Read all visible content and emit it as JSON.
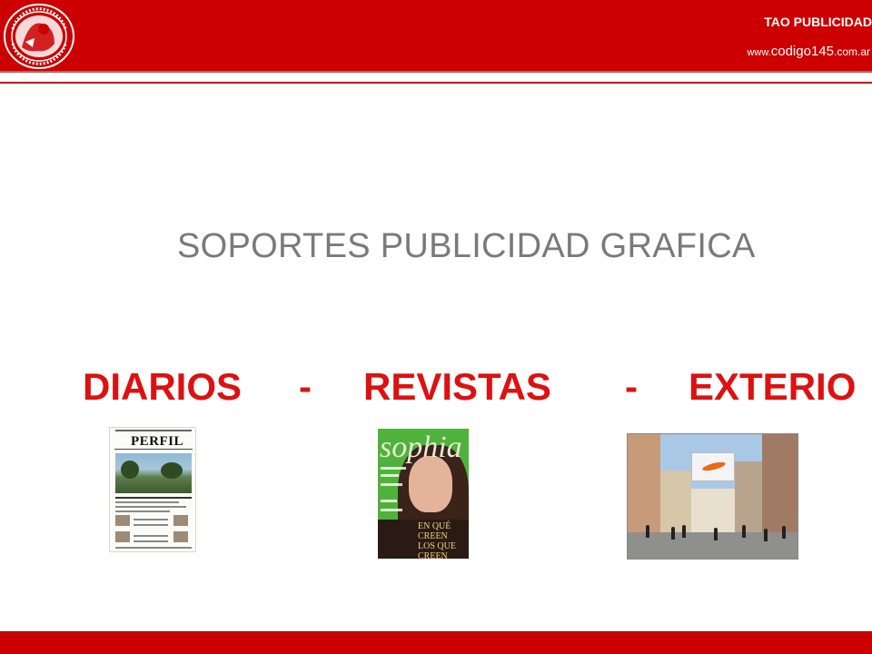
{
  "header": {
    "brand_title": "TAO PUBLICIDAD",
    "url_prefix": "www.",
    "url_domain": "codigo145",
    "url_suffix": ".com.ar",
    "seal_icon": "university-seal-icon",
    "accent_color": "#cc0000"
  },
  "slide": {
    "title": "SOPORTES PUBLICIDAD GRAFICA",
    "media_types": [
      "DIARIOS",
      "-",
      "REVISTAS",
      "-",
      "EXTERIO"
    ]
  },
  "thumbnails": {
    "newspaper_masthead": "PERFIL",
    "magazine_logo": "sophia",
    "magazine_headline_1": "EN QUÉ",
    "magazine_headline_2": "CREEN",
    "magazine_headline_3": "LOS QUE CREEN"
  }
}
